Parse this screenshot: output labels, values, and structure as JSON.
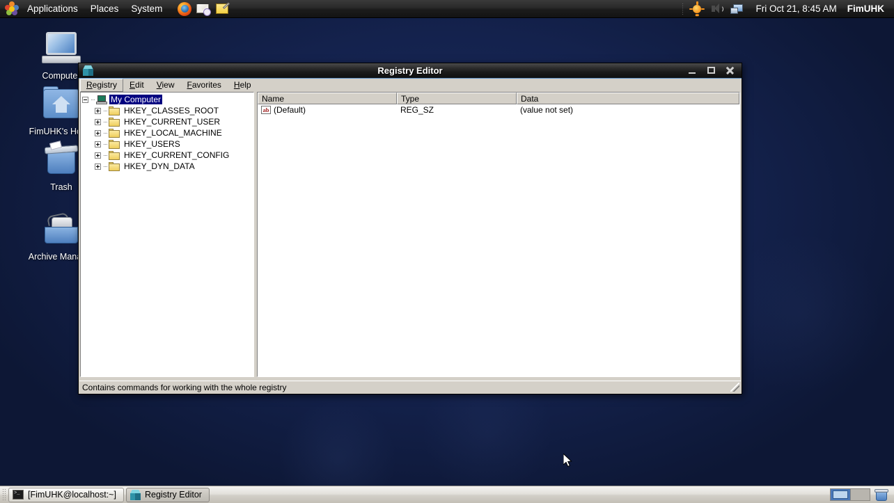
{
  "top_panel": {
    "menus": [
      {
        "label": "Applications",
        "name": "applications-menu"
      },
      {
        "label": "Places",
        "name": "places-menu"
      },
      {
        "label": "System",
        "name": "system-menu"
      }
    ],
    "launchers": [
      {
        "name": "firefox-icon",
        "title": "Firefox Web Browser"
      },
      {
        "name": "evolution-mail-icon",
        "title": "Evolution Mail"
      },
      {
        "name": "text-editor-icon",
        "title": "Text Editor"
      }
    ],
    "tray": [
      {
        "name": "brightness-icon",
        "title": "Brightness"
      },
      {
        "name": "volume-icon",
        "title": "Volume"
      },
      {
        "name": "network-icon",
        "title": "Network"
      }
    ],
    "clock": "Fri Oct 21,  8:45 AM",
    "user": "FimUHK"
  },
  "desktop": {
    "icons": [
      {
        "label": "Computer",
        "name": "desktop-icon-computer"
      },
      {
        "label": "FimUHK's Home",
        "name": "desktop-icon-home"
      },
      {
        "label": "Trash",
        "name": "desktop-icon-trash"
      },
      {
        "label": "Archive Manager",
        "name": "desktop-icon-archive-manager"
      }
    ]
  },
  "window": {
    "title": "Registry Editor",
    "icon": "registry-cube-icon",
    "controls": {
      "minimize": "Minimize",
      "maximize": "Maximize",
      "close": "Close"
    },
    "menubar": [
      {
        "label": "Registry",
        "accel": "R",
        "active": true
      },
      {
        "label": "Edit",
        "accel": "E",
        "active": false
      },
      {
        "label": "View",
        "accel": "V",
        "active": false
      },
      {
        "label": "Favorites",
        "accel": "F",
        "active": false
      },
      {
        "label": "Help",
        "accel": "H",
        "active": false
      }
    ],
    "tree": {
      "root": {
        "label": "My Computer",
        "selected": true,
        "expanded": true
      },
      "children": [
        {
          "label": "HKEY_CLASSES_ROOT",
          "expanded": false
        },
        {
          "label": "HKEY_CURRENT_USER",
          "expanded": false
        },
        {
          "label": "HKEY_LOCAL_MACHINE",
          "expanded": false
        },
        {
          "label": "HKEY_USERS",
          "expanded": false
        },
        {
          "label": "HKEY_CURRENT_CONFIG",
          "expanded": false
        },
        {
          "label": "HKEY_DYN_DATA",
          "expanded": false
        }
      ]
    },
    "list": {
      "columns": [
        "Name",
        "Type",
        "Data"
      ],
      "rows": [
        {
          "icon": "string-value-icon",
          "name": "(Default)",
          "type": "REG_SZ",
          "data": "(value not set)"
        }
      ]
    },
    "statusbar": "Contains commands for working with the whole registry"
  },
  "bottom_panel": {
    "tasks": [
      {
        "label": "[FimUHK@localhost:~]",
        "icon": "terminal-icon",
        "active": false
      },
      {
        "label": "Registry Editor",
        "icon": "registry-cube-icon",
        "active": true
      }
    ],
    "workspaces": {
      "count": 2,
      "active_index": 0
    },
    "trash": {
      "name": "trash-applet-icon"
    }
  },
  "colors": {
    "titlebar_accent": "#5b8ec4",
    "selection": "#000080",
    "chrome": "#d4d0c8",
    "desktop": "#14224d"
  }
}
